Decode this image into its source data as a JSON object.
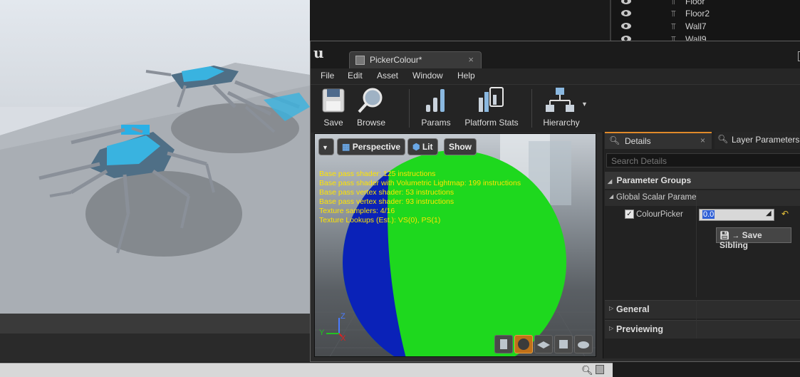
{
  "outliner": {
    "items": [
      {
        "name": "Floor"
      },
      {
        "name": "Floor2"
      },
      {
        "name": "Wall7"
      },
      {
        "name": "Wall9"
      }
    ]
  },
  "window": {
    "tab_title": "PickerColour*",
    "tab_close": "×"
  },
  "menubar": {
    "file": "File",
    "edit": "Edit",
    "asset": "Asset",
    "window": "Window",
    "help": "Help"
  },
  "toolbar": {
    "save": "Save",
    "browse": "Browse",
    "params": "Params",
    "platform_stats": "Platform Stats",
    "hierarchy": "Hierarchy"
  },
  "viewport": {
    "perspective": "Perspective",
    "lit": "Lit",
    "show": "Show",
    "stats": [
      "Base pass shader: 125 instructions",
      "Base pass shader with Volumetric Lightmap: 199 instructions",
      "Base pass vertex shader: 53 instructions",
      "Base pass vertex shader: 93 instructions",
      "Texture samplers: 4/16",
      "Texture Lookups (Est.): VS(0), PS(1)"
    ],
    "axis_z": "Z",
    "axis_y": "Y",
    "axis_x": "X"
  },
  "details": {
    "tab_details": "Details",
    "tab_layer": "Layer Parameters",
    "search_placeholder": "Search Details",
    "parameter_groups": "Parameter Groups",
    "global_scalar": "Global Scalar Parame",
    "param_name": "ColourPicker",
    "param_value": "0.0",
    "save_sibling": "Save Sibling",
    "general": "General",
    "previewing": "Previewing"
  },
  "colors": {
    "accent_orange": "#e08a2a",
    "sphere_green": "#1ed81e",
    "sphere_blue": "#0a22b8",
    "stats_yellow": "#ffe400"
  }
}
